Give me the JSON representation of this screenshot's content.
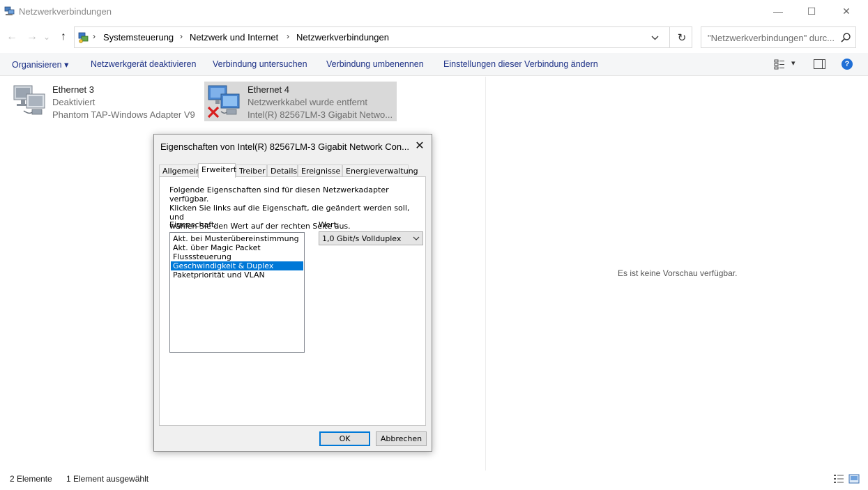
{
  "window": {
    "title": "Netzwerkverbindungen",
    "minimize_label": "—",
    "maximize_label": "☐",
    "close_label": "✕"
  },
  "navigation": {
    "back_icon": "←",
    "forward_icon": "→",
    "recent_icon": "⌄",
    "up_icon": "↑",
    "refresh_icon": "↻",
    "breadcrumbs": [
      "Systemsteuerung",
      "Netzwerk und Internet",
      "Netzwerkverbindungen"
    ],
    "separator": "›"
  },
  "search": {
    "placeholder": "\"Netzwerkverbindungen\" durc..."
  },
  "commandbar": {
    "organize": "Organisieren",
    "organize_arrow": "▾",
    "disable": "Netzwerkgerät deaktivieren",
    "diagnose": "Verbindung untersuchen",
    "rename": "Verbindung umbenennen",
    "settings": "Einstellungen dieser Verbindung ändern",
    "view_arrow": "▾",
    "help": "?"
  },
  "connections": [
    {
      "name": "Ethernet 3",
      "status": "Deaktiviert",
      "adapter": "Phantom TAP-Windows Adapter V9"
    },
    {
      "name": "Ethernet 4",
      "status": "Netzwerkkabel wurde entfernt",
      "adapter": "Intel(R) 82567LM-3 Gigabit Netwo..."
    }
  ],
  "preview": {
    "text": "Es ist keine Vorschau verfügbar."
  },
  "statusbar": {
    "count": "2 Elemente",
    "selected": "1 Element ausgewählt"
  },
  "dialog": {
    "title": "Eigenschaften von Intel(R) 82567LM-3 Gigabit Network Con...",
    "close_label": "✕",
    "tabs": [
      "Allgemein",
      "Erweitert",
      "Treiber",
      "Details",
      "Ereignisse",
      "Energieverwaltung"
    ],
    "active_tab": "Erweitert",
    "description_lines": [
      "Folgende Eigenschaften sind für diesen Netzwerkadapter verfügbar.",
      "Klicken Sie links auf die Eigenschaft, die geändert werden soll, und",
      "wählen Sie den Wert auf der rechten Seite aus."
    ],
    "property_label": "Eigenschaft:",
    "value_label": "Wert:",
    "properties": [
      "Akt. bei Musterübereinstimmung",
      "Akt. über Magic Packet",
      "Flusssteuerung",
      "Geschwindigkeit & Duplex",
      "Paketpriorität und VLAN"
    ],
    "selected_property": "Geschwindigkeit & Duplex",
    "value": "1,0 Gbit/s Vollduplex",
    "ok": "OK",
    "cancel": "Abbrechen"
  },
  "colors": {
    "accent": "#0078d7",
    "command_text": "#1e3287",
    "selection_bg": "#d9d9d9"
  }
}
